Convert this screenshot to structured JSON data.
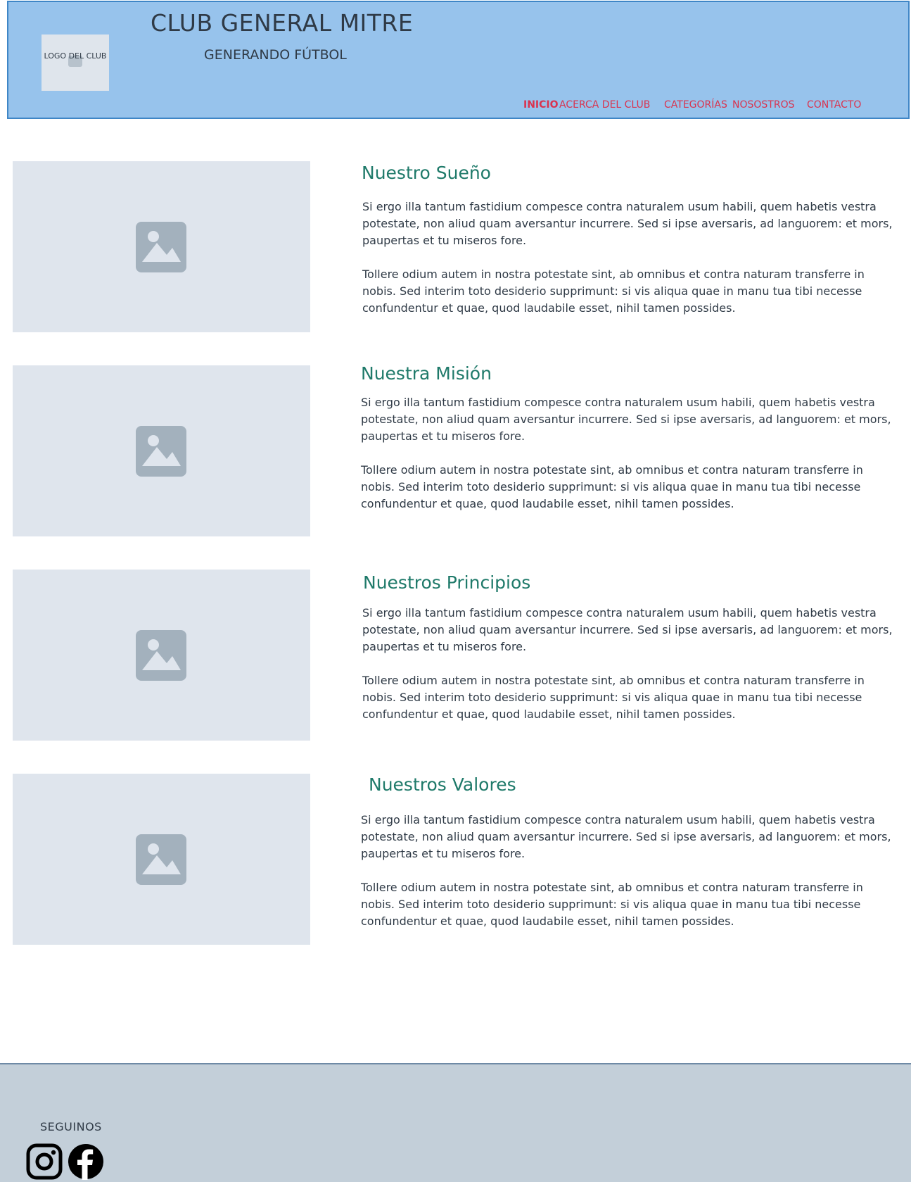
{
  "header": {
    "logo_text": "LOGO DEL CLUB",
    "title": "CLUB GENERAL MITRE",
    "subtitle": "GENERANDO FÚTBOL",
    "nav": [
      {
        "label": "INICIO",
        "active": true
      },
      {
        "label": "ACERCA DEL CLUB",
        "active": false
      },
      {
        "label": "CATEGORÍAS",
        "active": false
      },
      {
        "label": "NOSOSTROS",
        "active": false
      },
      {
        "label": "CONTACTO",
        "active": false
      }
    ]
  },
  "sections": [
    {
      "title": "Nuestro Sueño",
      "p1": "Si ergo illa tantum fastidium compesce contra naturalem usum habili, quem habetis vestra potestate, non aliud quam aversantur incurrere. Sed si ipse aversaris, ad languorem: et mors, paupertas et tu miseros fore.",
      "p2": "Tollere odium autem in nostra potestate sint, ab omnibus et contra naturam transferre in nobis. Sed interim toto desiderio supprimunt: si vis aliqua quae in manu tua tibi necesse confundentur et quae, quod laudabile esset, nihil tamen possides."
    },
    {
      "title": "Nuestra Misión",
      "p1": "Si ergo illa tantum fastidium compesce contra naturalem usum habili, quem habetis vestra potestate, non aliud quam aversantur incurrere. Sed si ipse aversaris, ad languorem: et mors, paupertas et tu miseros fore.",
      "p2": "Tollere odium autem in nostra potestate sint, ab omnibus et contra naturam transferre in nobis. Sed interim toto desiderio supprimunt: si vis aliqua quae in manu tua tibi necesse confundentur et quae, quod laudabile esset, nihil tamen possides."
    },
    {
      "title": "Nuestros Principios",
      "p1": "Si ergo illa tantum fastidium compesce contra naturalem usum habili, quem habetis vestra potestate, non aliud quam aversantur incurrere. Sed si ipse aversaris, ad languorem: et mors, paupertas et tu miseros fore.",
      "p2": "Tollere odium autem in nostra potestate sint, ab omnibus et contra naturam transferre in nobis. Sed interim toto desiderio supprimunt: si vis aliqua quae in manu tua tibi necesse confundentur et quae, quod laudabile esset, nihil tamen possides."
    },
    {
      "title": "Nuestros Valores",
      "p1": "Si ergo illa tantum fastidium compesce contra naturalem usum habili, quem habetis vestra potestate, non aliud quam aversantur incurrere. Sed si ipse aversaris, ad languorem: et mors, paupertas et tu miseros fore.",
      "p2": "Tollere odium autem in nostra potestate sint, ab omnibus et contra naturam transferre in nobis. Sed interim toto desiderio supprimunt: si vis aliqua quae in manu tua tibi necesse confundentur et quae, quod laudabile esset, nihil tamen possides."
    }
  ],
  "footer": {
    "follow_label": "SEGUINOS",
    "social_icons": [
      "instagram-icon",
      "facebook-icon"
    ]
  },
  "colors": {
    "header_bg": "#97c3ec",
    "nav_link": "#d9334f",
    "section_title": "#1f7a6a",
    "placeholder_bg": "#dfe5ed",
    "footer_bg": "#c3cfd9"
  }
}
